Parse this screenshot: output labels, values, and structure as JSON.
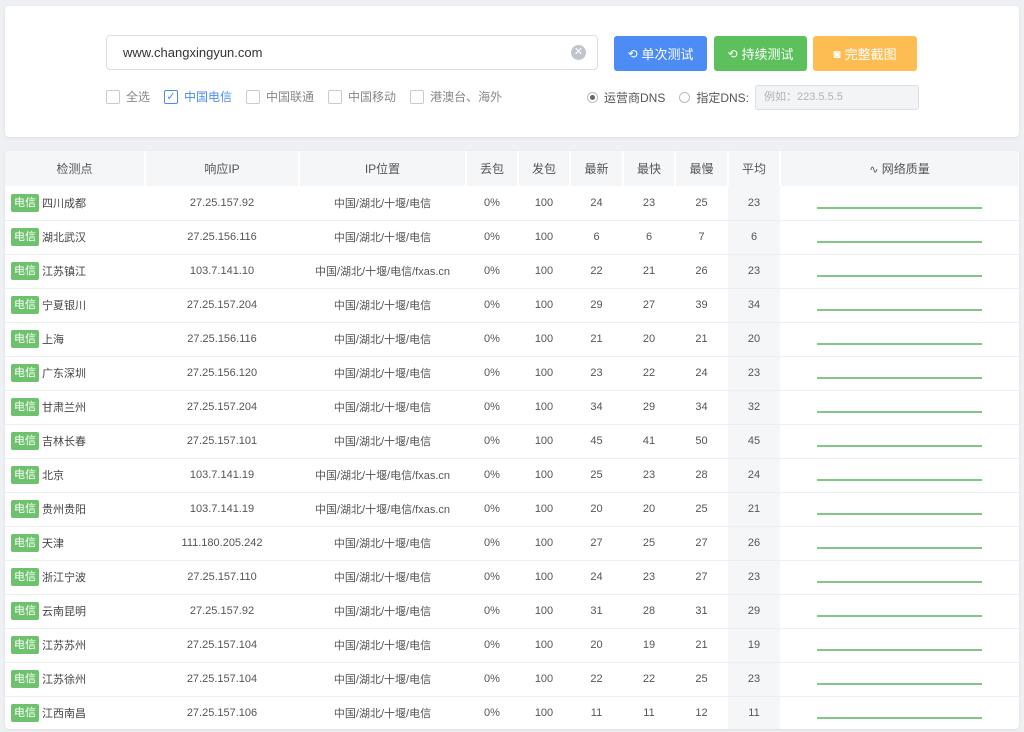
{
  "search": {
    "value": "www.changxingyun.com"
  },
  "buttons": {
    "single_label": "单次测试",
    "continuous_label": "持续测试",
    "screenshot_label": "完整截图"
  },
  "isp_filters": [
    {
      "label": "全选",
      "checked": false
    },
    {
      "label": "中国电信",
      "checked": true
    },
    {
      "label": "中国联通",
      "checked": false
    },
    {
      "label": "中国移动",
      "checked": false
    },
    {
      "label": "港澳台、海外",
      "checked": false
    }
  ],
  "dns": {
    "operator_label": "运营商DNS",
    "custom_label": "指定DNS:",
    "custom_placeholder": "例如：223.5.5.5",
    "selected": "operator"
  },
  "table": {
    "columns": [
      "检测点",
      "响应IP",
      "IP位置",
      "丢包",
      "发包",
      "最新",
      "最快",
      "最慢",
      "平均",
      "网络质量"
    ],
    "rows": [
      {
        "isp": "电信",
        "node": "四川成都",
        "ip": "27.25.157.92",
        "location": "中国/湖北/十堰/电信",
        "loss": "0%",
        "sent": "100",
        "latest": "24",
        "fastest": "23",
        "slowest": "25",
        "avg": "23"
      },
      {
        "isp": "电信",
        "node": "湖北武汉",
        "ip": "27.25.156.116",
        "location": "中国/湖北/十堰/电信",
        "loss": "0%",
        "sent": "100",
        "latest": "6",
        "fastest": "6",
        "slowest": "7",
        "avg": "6"
      },
      {
        "isp": "电信",
        "node": "江苏镇江",
        "ip": "103.7.141.10",
        "location": "中国/湖北/十堰/电信/fxas.cn",
        "loss": "0%",
        "sent": "100",
        "latest": "22",
        "fastest": "21",
        "slowest": "26",
        "avg": "23"
      },
      {
        "isp": "电信",
        "node": "宁夏银川",
        "ip": "27.25.157.204",
        "location": "中国/湖北/十堰/电信",
        "loss": "0%",
        "sent": "100",
        "latest": "29",
        "fastest": "27",
        "slowest": "39",
        "avg": "34"
      },
      {
        "isp": "电信",
        "node": "上海",
        "ip": "27.25.156.116",
        "location": "中国/湖北/十堰/电信",
        "loss": "0%",
        "sent": "100",
        "latest": "21",
        "fastest": "20",
        "slowest": "21",
        "avg": "20"
      },
      {
        "isp": "电信",
        "node": "广东深圳",
        "ip": "27.25.156.120",
        "location": "中国/湖北/十堰/电信",
        "loss": "0%",
        "sent": "100",
        "latest": "23",
        "fastest": "22",
        "slowest": "24",
        "avg": "23"
      },
      {
        "isp": "电信",
        "node": "甘肃兰州",
        "ip": "27.25.157.204",
        "location": "中国/湖北/十堰/电信",
        "loss": "0%",
        "sent": "100",
        "latest": "34",
        "fastest": "29",
        "slowest": "34",
        "avg": "32"
      },
      {
        "isp": "电信",
        "node": "吉林长春",
        "ip": "27.25.157.101",
        "location": "中国/湖北/十堰/电信",
        "loss": "0%",
        "sent": "100",
        "latest": "45",
        "fastest": "41",
        "slowest": "50",
        "avg": "45"
      },
      {
        "isp": "电信",
        "node": "北京",
        "ip": "103.7.141.19",
        "location": "中国/湖北/十堰/电信/fxas.cn",
        "loss": "0%",
        "sent": "100",
        "latest": "25",
        "fastest": "23",
        "slowest": "28",
        "avg": "24"
      },
      {
        "isp": "电信",
        "node": "贵州贵阳",
        "ip": "103.7.141.19",
        "location": "中国/湖北/十堰/电信/fxas.cn",
        "loss": "0%",
        "sent": "100",
        "latest": "20",
        "fastest": "20",
        "slowest": "25",
        "avg": "21"
      },
      {
        "isp": "电信",
        "node": "天津",
        "ip": "111.180.205.242",
        "location": "中国/湖北/十堰/电信",
        "loss": "0%",
        "sent": "100",
        "latest": "27",
        "fastest": "25",
        "slowest": "27",
        "avg": "26"
      },
      {
        "isp": "电信",
        "node": "浙江宁波",
        "ip": "27.25.157.110",
        "location": "中国/湖北/十堰/电信",
        "loss": "0%",
        "sent": "100",
        "latest": "24",
        "fastest": "23",
        "slowest": "27",
        "avg": "23"
      },
      {
        "isp": "电信",
        "node": "云南昆明",
        "ip": "27.25.157.92",
        "location": "中国/湖北/十堰/电信",
        "loss": "0%",
        "sent": "100",
        "latest": "31",
        "fastest": "28",
        "slowest": "31",
        "avg": "29"
      },
      {
        "isp": "电信",
        "node": "江苏苏州",
        "ip": "27.25.157.104",
        "location": "中国/湖北/十堰/电信",
        "loss": "0%",
        "sent": "100",
        "latest": "20",
        "fastest": "19",
        "slowest": "21",
        "avg": "19"
      },
      {
        "isp": "电信",
        "node": "江苏徐州",
        "ip": "27.25.157.104",
        "location": "中国/湖北/十堰/电信",
        "loss": "0%",
        "sent": "100",
        "latest": "22",
        "fastest": "22",
        "slowest": "25",
        "avg": "23"
      },
      {
        "isp": "电信",
        "node": "江西南昌",
        "ip": "27.25.157.106",
        "location": "中国/湖北/十堰/电信",
        "loss": "0%",
        "sent": "100",
        "latest": "11",
        "fastest": "11",
        "slowest": "12",
        "avg": "11"
      }
    ]
  },
  "colors": {
    "primary": "#4d8cf5",
    "success": "#5cc05c",
    "warning": "#fdbd52",
    "sparkline": "#3aa33a"
  }
}
